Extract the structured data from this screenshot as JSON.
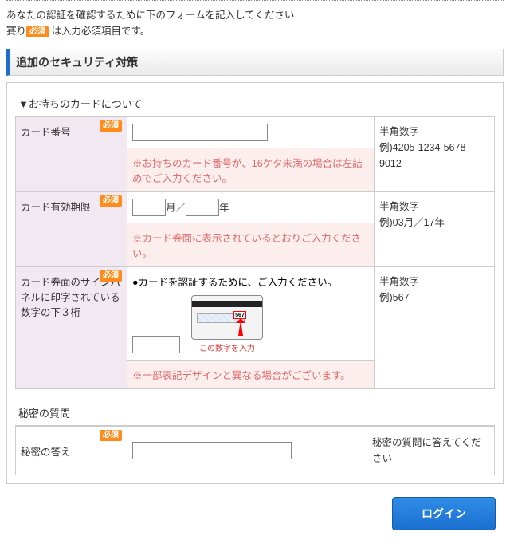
{
  "intro": {
    "line1": "あなたの認証を確認するために下のフォームを記入してください",
    "prefix": "賽り",
    "req_label": "必須",
    "suffix": "は入力必須項目です。"
  },
  "section_title": "追加のセキュリティ対策",
  "card_section": {
    "title": "▼お持ちのカードについて",
    "rows": {
      "number": {
        "label": "カード番号",
        "hint_l1": "半角数字",
        "hint_l2": "例)4205-1234-5678-9012",
        "note": "※お持ちのカード番号が、16ケタ未満の場合は左詰めでご入力ください。"
      },
      "expiry": {
        "label": "カード有効期限",
        "month_suffix": "月／",
        "year_suffix": "年",
        "hint_l1": "半角数字",
        "hint_l2": "例)03月／17年",
        "note": "※カード券面に表示されているとおりご入力ください。"
      },
      "cvv": {
        "label": "カード券面のサインパネルに印字されている数字の下３桁",
        "lead": "●カードを認証するために、ご入力ください。",
        "caption": "この数字を入力",
        "cvv_sample": "567",
        "hint_l1": "半角数字",
        "hint_l2": "例)567",
        "note": "※一部表記デザインと異なる場合がございます。"
      }
    }
  },
  "secret": {
    "title": "秘密の質問",
    "answer_label": "秘密の答え",
    "hint": "秘密の質問に答えてください"
  },
  "login_button": "ログイン"
}
